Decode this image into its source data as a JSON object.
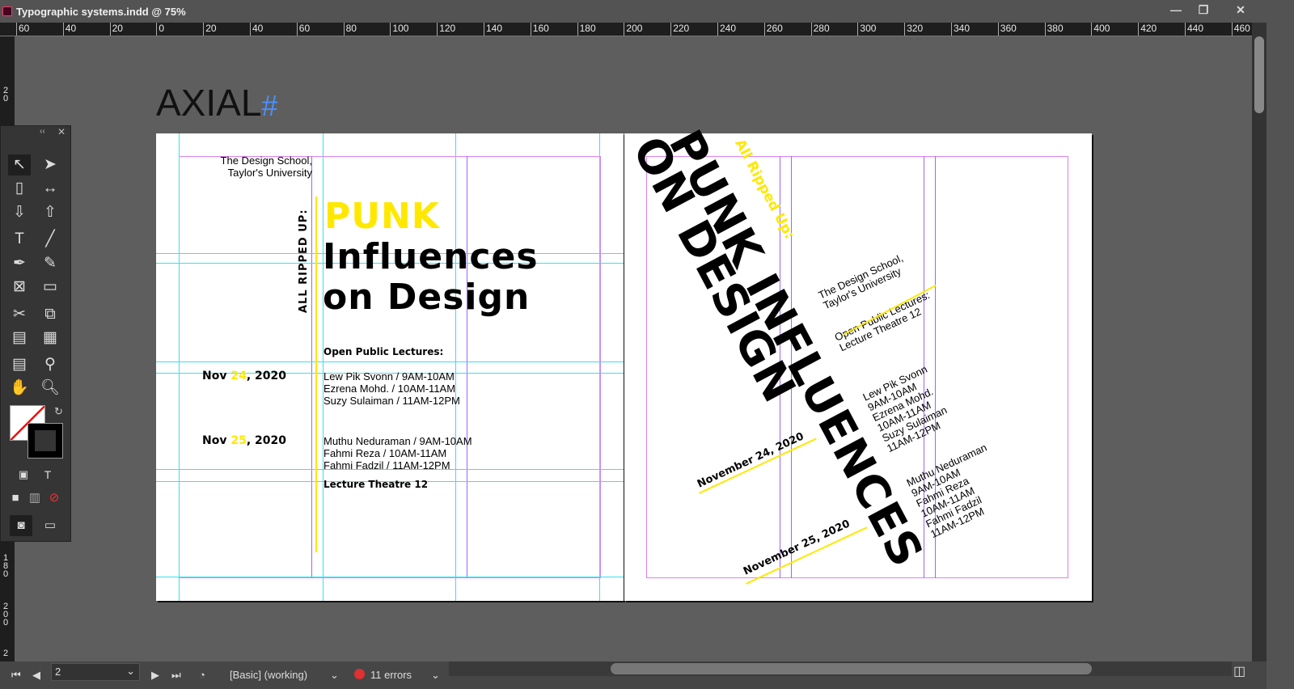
{
  "window": {
    "title": "Typographic systems.indd @ 75%",
    "minimize": "—",
    "restore": "❐",
    "close": "✕"
  },
  "ruler": {
    "h_labels": [
      "60",
      "40",
      "20",
      "0",
      "20",
      "40",
      "60",
      "80",
      "100",
      "120",
      "140",
      "160",
      "180",
      "200",
      "220",
      "240",
      "260",
      "280",
      "300",
      "320",
      "340",
      "360",
      "380",
      "400",
      "420",
      "440",
      "460"
    ],
    "v_labels": [
      "20",
      "180",
      "200",
      "2"
    ]
  },
  "document": {
    "heading": "AXIAL",
    "heading_mark": "#"
  },
  "left_page": {
    "school": "The Design School,",
    "university": "Taylor's University",
    "vertical_title": "ALL RIPPED UP:",
    "title1": "PUNK",
    "title2": "Influences",
    "title3": "on Design",
    "lectures": "Open Public Lectures:",
    "date1_a": "Nov ",
    "date1_b": "24",
    "date1_c": ", 2020",
    "date2_a": "Nov ",
    "date2_b": "25",
    "date2_c": ", 2020",
    "day1": [
      "Lew Pik Svonn / 9AM-10AM",
      "Ezrena Mohd. / 10AM-11AM",
      "Suzy Sulaiman / 11AM-12PM"
    ],
    "day2": [
      "Muthu Neduraman / 9AM-10AM",
      "Fahmi Reza / 10AM-11AM",
      "Fahmi Fadzil / 11AM-12PM"
    ],
    "venue": "Lecture Theatre 12"
  },
  "right_page": {
    "title1": "PUNK INFLUENCES",
    "title2": "ON DESIGN",
    "subtitle": "All Ripped Up:",
    "school": "The Design School,",
    "university": "Taylor's University",
    "lectures": "Open Public Lectures:",
    "venue": "Lecture Theatre 12",
    "date1": "November 24, 2020",
    "date2": "November 25, 2020",
    "day1": [
      "Lew Pik Svonn",
      "9AM-10AM",
      "Ezrena Mohd.",
      "10AM-11AM",
      "Suzy Sulaiman",
      "11AM-12PM"
    ],
    "day2": [
      "Muthu Neduraman",
      "9AM-10AM",
      "Fahmi Reza",
      "10AM-11AM",
      "Fahmi Fadzil",
      "11AM-12PM"
    ]
  },
  "status": {
    "page": "2",
    "preflight_profile": "[Basic] (working)",
    "errors": "11 errors",
    "error_color": "#e03030"
  },
  "colors": {
    "accent_yellow": "#ffe800",
    "guide_cyan": "#38e0f0",
    "margin_magenta": "#e080f0",
    "column_violet": "#9966ff"
  }
}
